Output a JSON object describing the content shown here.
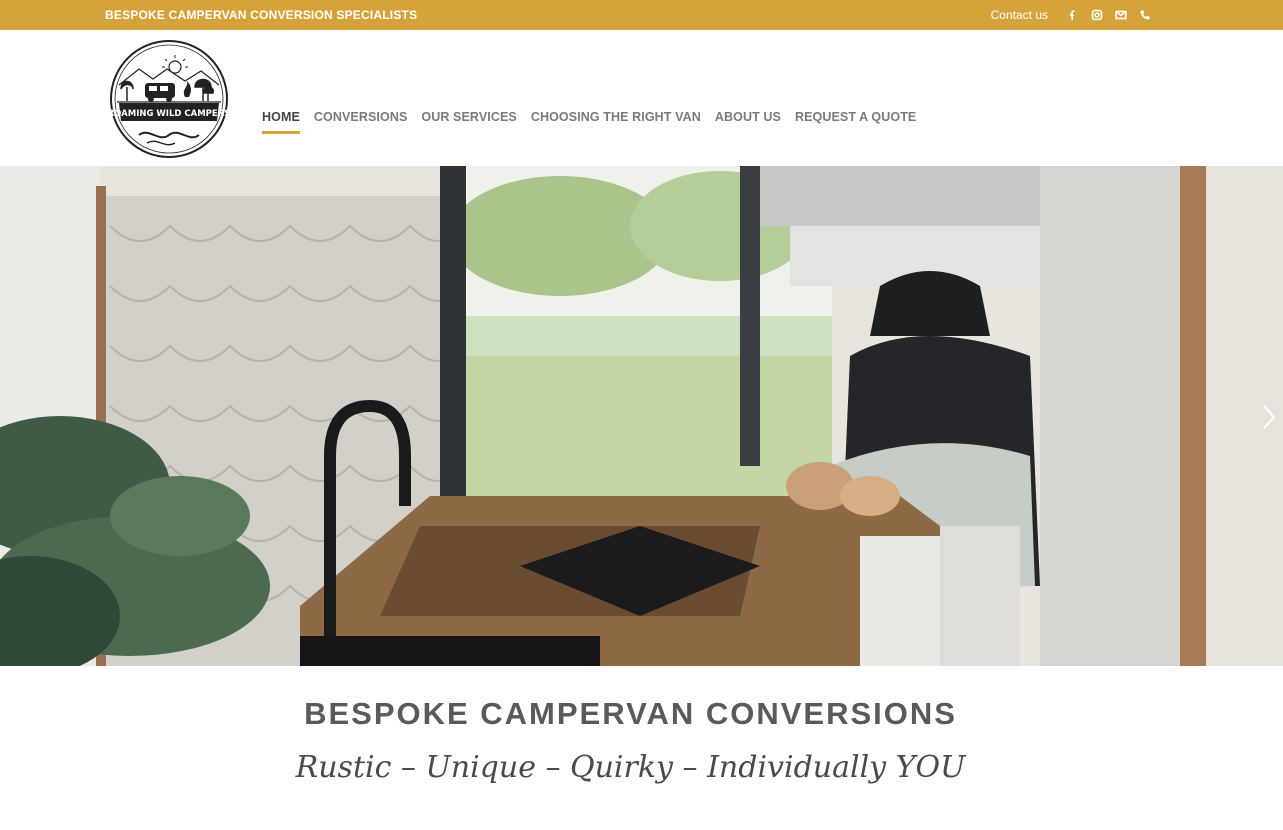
{
  "topbar": {
    "tagline": "BESPOKE CAMPERVAN CONVERSION SPECIALISTS",
    "contact_label": "Contact us",
    "social_icons": [
      "facebook-icon",
      "instagram-icon",
      "email-icon",
      "phone-icon"
    ],
    "color": "#d6a23a"
  },
  "logo": {
    "text": "ROAMING WILD CAMPERS"
  },
  "nav": {
    "items": [
      {
        "label": "HOME",
        "active": true
      },
      {
        "label": "CONVERSIONS"
      },
      {
        "label": "OUR SERVICES"
      },
      {
        "label": "CHOOSING THE RIGHT VAN"
      },
      {
        "label": "ABOUT US"
      },
      {
        "label": "REQUEST A QUOTE"
      }
    ]
  },
  "hero": {
    "next_icon": "chevron-right-icon"
  },
  "content": {
    "headline": "BESPOKE CAMPERVAN CONVERSIONS",
    "subline": "Rustic – Unique – Quirky – Individually YOU"
  }
}
